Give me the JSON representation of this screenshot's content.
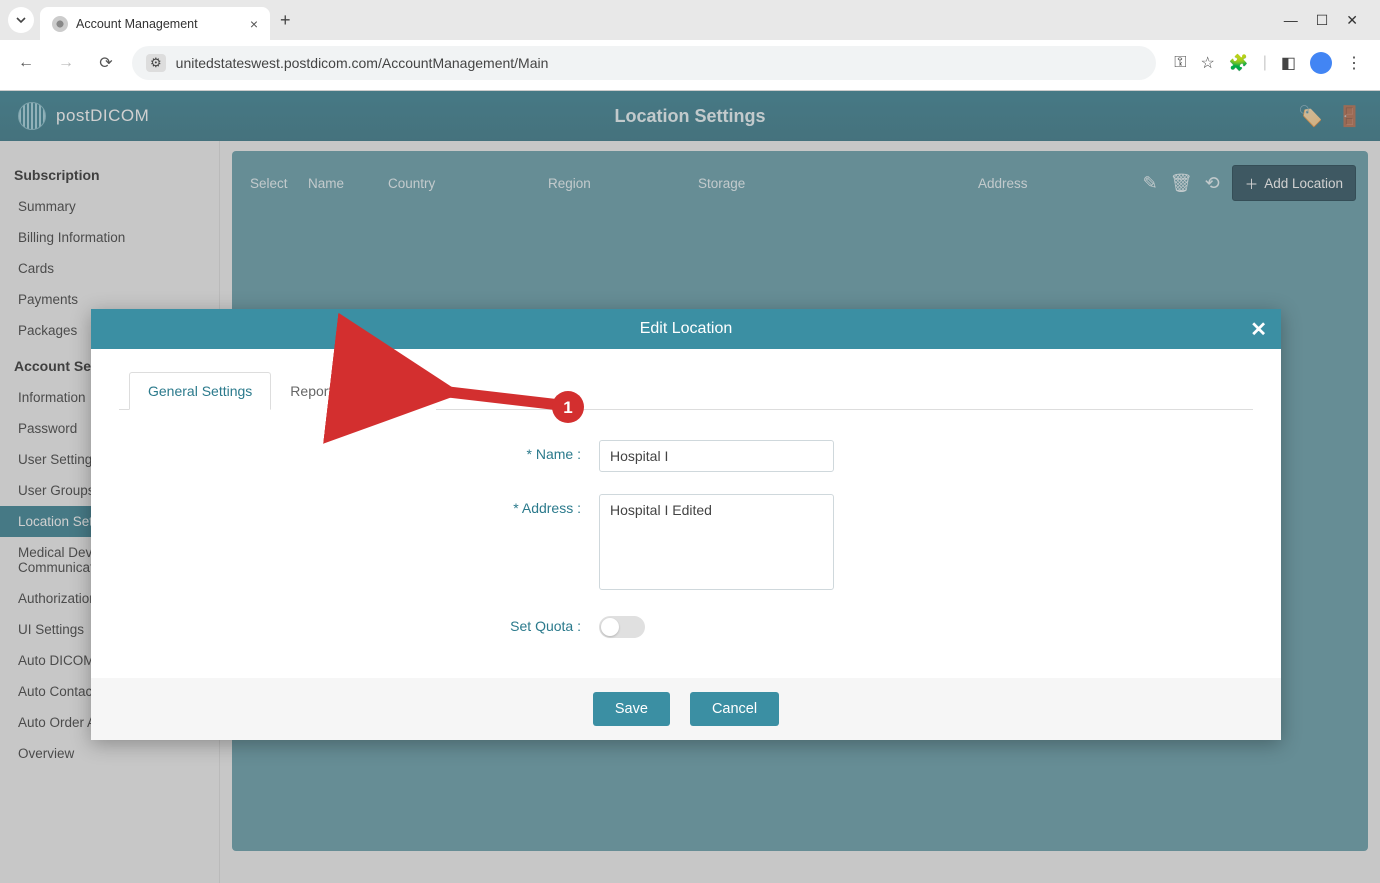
{
  "browser": {
    "tab_title": "Account Management",
    "url": "unitedstateswest.postdicom.com/AccountManagement/Main"
  },
  "header": {
    "brand": "postDICOM",
    "title": "Location Settings"
  },
  "sidebar": {
    "group1": "Subscription",
    "items1": [
      "Summary",
      "Billing Information",
      "Cards",
      "Payments",
      "Packages"
    ],
    "group2": "Account Settings",
    "items2": [
      "Information",
      "Password",
      "User Settings",
      "User Groups",
      "Location Settings",
      "Medical Device Communication",
      "Authorizations",
      "UI Settings",
      "Auto DICOM Send Settings",
      "Auto Contact Send Settings",
      "Auto Order Assign Settings",
      "Overview"
    ]
  },
  "table": {
    "headers": {
      "select": "Select",
      "name": "Name",
      "country": "Country",
      "region": "Region",
      "storage": "Storage",
      "address": "Address"
    },
    "add_button": "Add Location"
  },
  "modal": {
    "title": "Edit Location",
    "tabs": {
      "general": "General Settings",
      "report": "Report Print Options"
    },
    "labels": {
      "name": "* Name :",
      "address": "* Address :",
      "quota": "Set Quota :"
    },
    "values": {
      "name": "Hospital I",
      "address": "Hospital I Edited"
    },
    "buttons": {
      "save": "Save",
      "cancel": "Cancel"
    }
  },
  "annotation": {
    "step": "1"
  }
}
